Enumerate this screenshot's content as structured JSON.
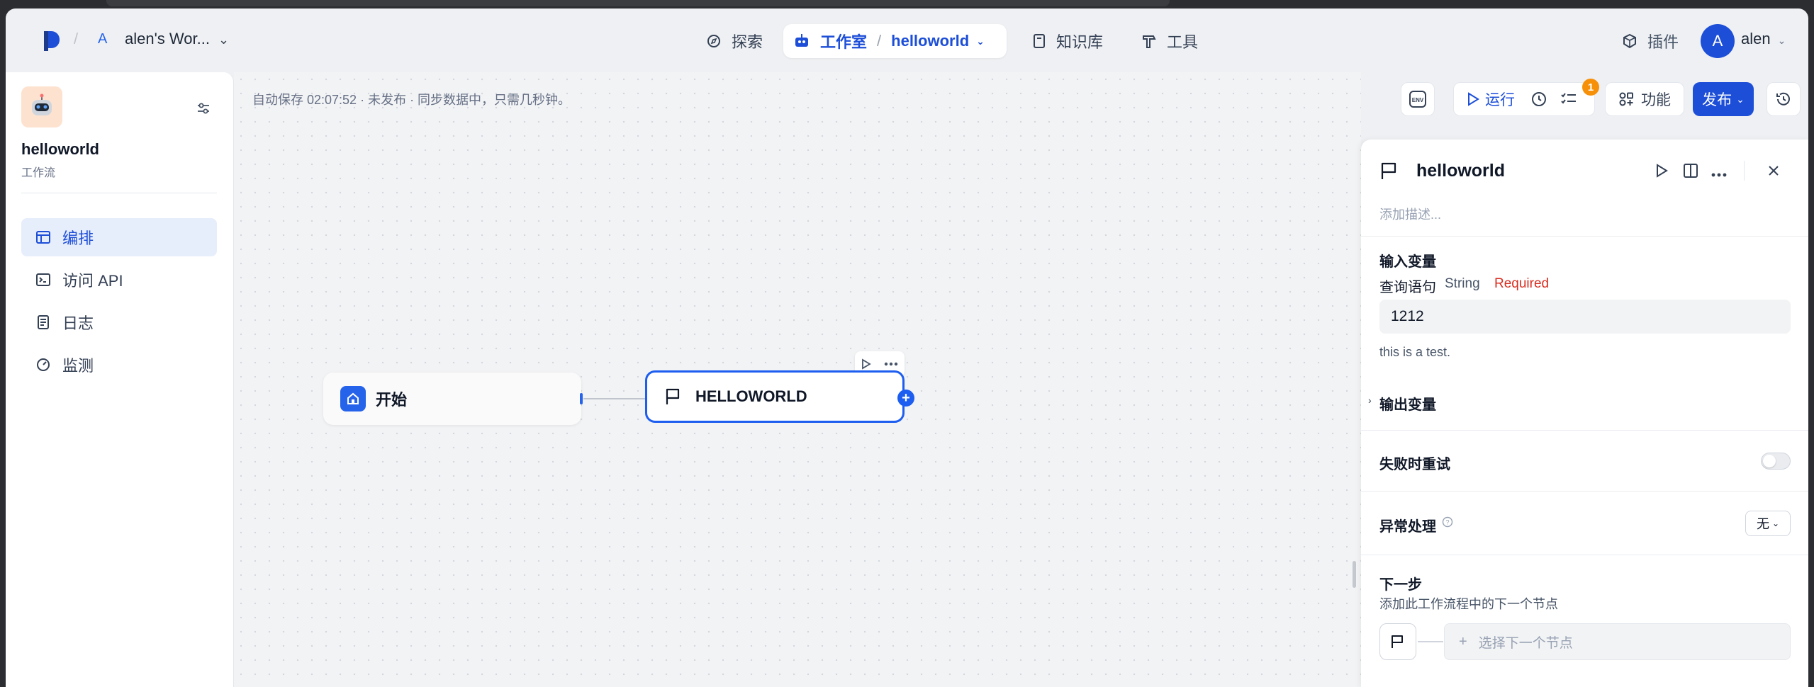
{
  "workspace": {
    "badge": "A",
    "name": "alen's Wor..."
  },
  "nav": {
    "explore": "探索",
    "studio": "工作室",
    "project": "helloworld",
    "knowledge": "知识库",
    "tools": "工具",
    "plugins": "插件",
    "user_initial": "A",
    "user_name": "alen"
  },
  "sidebar": {
    "app_title": "helloworld",
    "app_type": "工作流",
    "items": [
      {
        "label": "编排",
        "icon": "layout-icon",
        "active": true
      },
      {
        "label": "访问 API",
        "icon": "terminal-icon",
        "active": false
      },
      {
        "label": "日志",
        "icon": "log-icon",
        "active": false
      },
      {
        "label": "监测",
        "icon": "gauge-icon",
        "active": false
      }
    ]
  },
  "canvas": {
    "autosave": "自动保存 02:07:52 · 未发布 · 同步数据中，只需几秒钟。",
    "toolbar": {
      "env": "ENV",
      "run": "运行",
      "checklist_count": "1",
      "features": "功能",
      "publish": "发布"
    },
    "nodes": {
      "start": "开始",
      "helloworld": "HELLOWORLD"
    }
  },
  "panel": {
    "title": "helloworld",
    "desc_placeholder": "添加描述...",
    "input_section": "输入变量",
    "var_name": "查询语句",
    "var_type": "String",
    "var_required": "Required",
    "var_value": "1212",
    "var_desc": "this is a test.",
    "output_section": "输出变量",
    "retry_label": "失败时重试",
    "error_label": "异常处理",
    "error_value": "无",
    "next_title": "下一步",
    "next_desc": "添加此工作流程中的下一个节点",
    "next_placeholder": "选择下一个节点"
  },
  "colors": {
    "accent": "#1d4ed8",
    "badge": "#f79009",
    "required": "#d92d20"
  }
}
